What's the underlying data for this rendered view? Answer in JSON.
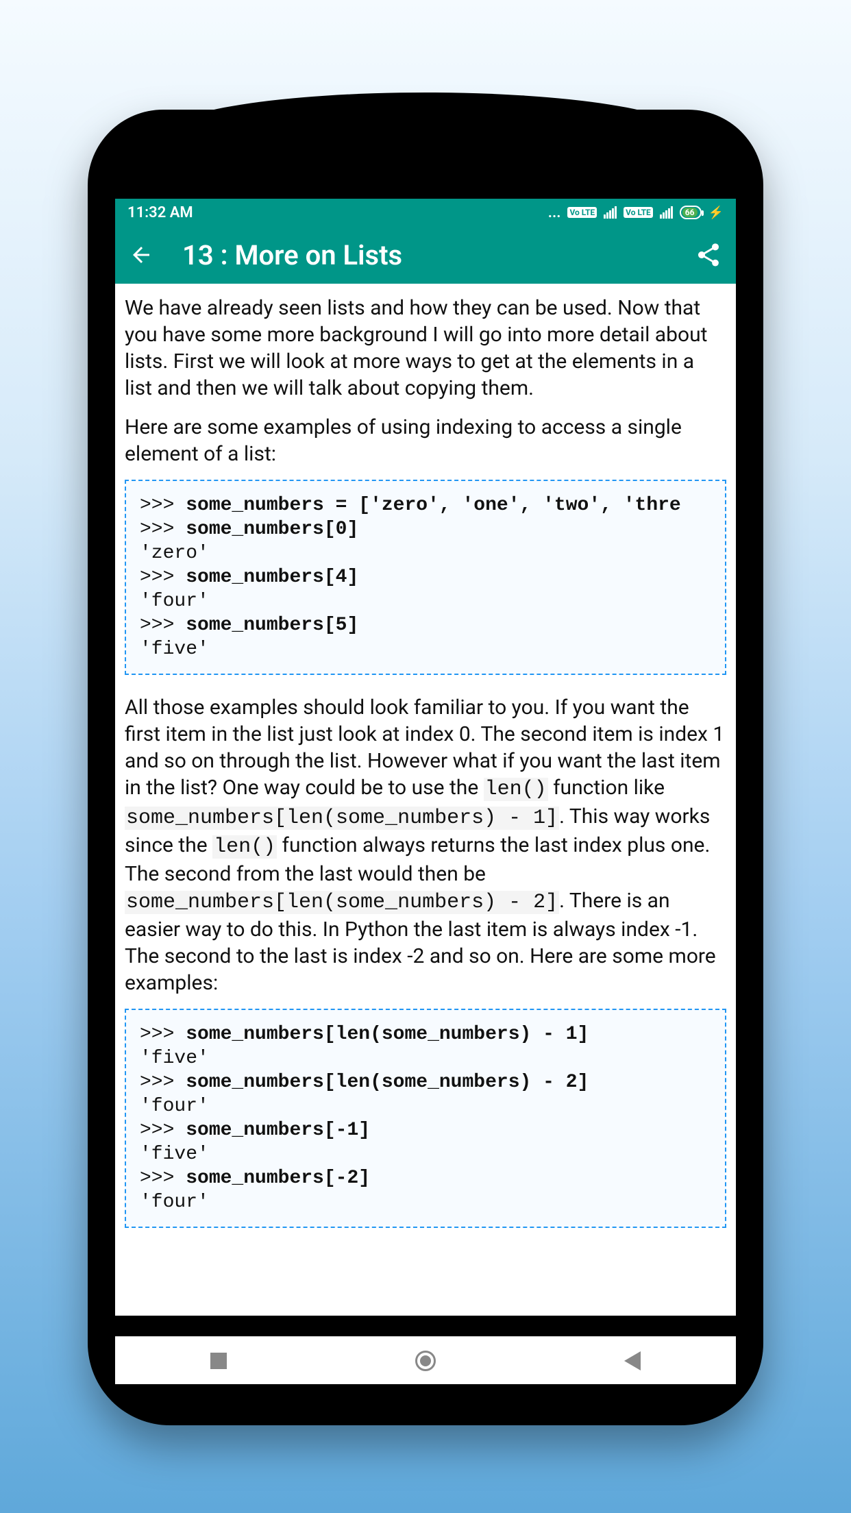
{
  "status": {
    "time": "11:32 AM",
    "battery": "66",
    "volte": "Vo LTE"
  },
  "appbar": {
    "title": "13 : More on Lists"
  },
  "content": {
    "p1": "We have already seen lists and how they can be used. Now that you have some more background I will go into more detail about lists. First we will look at more ways to get at the elements in a list and then we will talk about copying them.",
    "p2": "Here are some examples of using indexing to access a single element of a list:",
    "code1": {
      "l1p": ">>> ",
      "l1b": "some_numbers = ['zero', 'one', 'two', 'thre",
      "l2p": ">>> ",
      "l2b": "some_numbers[0]",
      "l3": "'zero'",
      "l4p": ">>> ",
      "l4b": "some_numbers[4]",
      "l5": "'four'",
      "l6p": ">>> ",
      "l6b": "some_numbers[5]",
      "l7": "'five'"
    },
    "p3a": "All those examples should look familiar to you. If you want the first item in the list just look at index 0. The second item is index 1 and so on through the list. However what if you want the last item in the list? One way could be to use the ",
    "p3_code1": "len()",
    "p3b": " function like ",
    "p3_code2": "some_numbers[len(some_numbers) - 1]",
    "p3c": ". This way works since the ",
    "p3_code3": "len()",
    "p3d": " function always returns the last index plus one. The second from the last would then be ",
    "p3_code4": "some_numbers[len(some_numbers) - 2]",
    "p3e": ". There is an easier way to do this. In Python the last item is always index -1. The second to the last is index -2 and so on. Here are some more examples:",
    "code2": {
      "l1p": ">>> ",
      "l1b": "some_numbers[len(some_numbers) - 1]",
      "l2": "'five'",
      "l3p": ">>> ",
      "l3b": "some_numbers[len(some_numbers) - 2]",
      "l4": "'four'",
      "l5p": ">>> ",
      "l5b": "some_numbers[-1]",
      "l6": "'five'",
      "l7p": ">>> ",
      "l7b": "some_numbers[-2]",
      "l8": "'four'"
    }
  }
}
